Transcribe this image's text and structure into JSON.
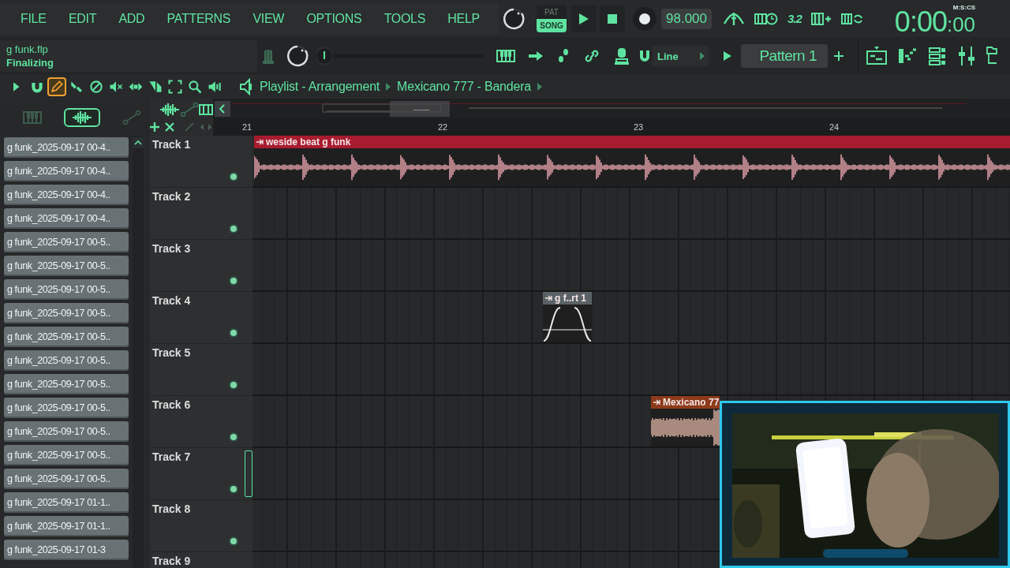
{
  "menu": [
    "FILE",
    "EDIT",
    "ADD",
    "PATTERNS",
    "VIEW",
    "OPTIONS",
    "TOOLS",
    "HELP"
  ],
  "transport": {
    "modes": [
      {
        "label": "PAT",
        "selected": false
      },
      {
        "label": "SONG",
        "selected": true
      }
    ],
    "tempo": "98.000",
    "step_readout": "3.2",
    "time": "0:00",
    "time_centis": ":00",
    "time_format": "M:S:CS"
  },
  "hint_bar": {
    "title": "g funk.flp",
    "message": "Finalizing"
  },
  "master_slider": {
    "level": 0.06
  },
  "snap": {
    "value": "Line"
  },
  "pattern": {
    "value": "Pattern 1"
  },
  "playlist_tools": [
    {
      "selected": false
    },
    {
      "selected": false
    },
    {
      "selected": true
    },
    {
      "selected": false
    },
    {
      "selected": false
    },
    {
      "selected": false
    },
    {
      "selected": false
    },
    {
      "selected": false
    },
    {
      "selected": false
    },
    {
      "selected": false
    },
    {
      "selected": false
    }
  ],
  "breadcrumb": [
    "Playlist - Arrangement",
    "Mexicano 777 - Bandera"
  ],
  "browser": {
    "filters": [
      {
        "selected": false
      },
      {
        "selected": true
      },
      {
        "selected": false
      }
    ],
    "files": [
      "g funk_2025-09-17 00-4..",
      "g funk_2025-09-17 00-4..",
      "g funk_2025-09-17 00-4..",
      "g funk_2025-09-17 00-4..",
      "g funk_2025-09-17 00-5..",
      "g funk_2025-09-17 00-5..",
      "g funk_2025-09-17 00-5..",
      "g funk_2025-09-17 00-5..",
      "g funk_2025-09-17 00-5..",
      "g funk_2025-09-17 00-5..",
      "g funk_2025-09-17 00-5..",
      "g funk_2025-09-17 00-5..",
      "g funk_2025-09-17 00-5..",
      "g funk_2025-09-17 00-5..",
      "g funk_2025-09-17 00-5..",
      "g funk_2025-09-17 01-1..",
      "g funk_2025-09-17 01-1..",
      "g funk_2025-09-17 01-3"
    ]
  },
  "ruler": [
    "21",
    "22",
    "23",
    "24"
  ],
  "tracks": [
    {
      "name": "Track 1",
      "selected": false,
      "enabled": true,
      "clips": [
        {
          "kind": "audio",
          "label": "weside beat g funk",
          "color": "#a81c30"
        }
      ]
    },
    {
      "name": "Track 2",
      "selected": false,
      "enabled": true
    },
    {
      "name": "Track 3",
      "selected": false,
      "enabled": true
    },
    {
      "name": "Track 4",
      "selected": false,
      "enabled": true,
      "clips": [
        {
          "kind": "automation",
          "label": "g f..rt 1",
          "color": "#5a6266"
        }
      ]
    },
    {
      "name": "Track 5",
      "selected": false,
      "enabled": true
    },
    {
      "name": "Track 6",
      "selected": false,
      "enabled": true,
      "clips": [
        {
          "kind": "audio",
          "label": "Mexicano 77",
          "color": "#8e3a1a"
        }
      ]
    },
    {
      "name": "Track 7",
      "selected": true,
      "enabled": true
    },
    {
      "name": "Track 8",
      "selected": false,
      "enabled": true
    },
    {
      "name": "Track 9",
      "selected": false
    }
  ],
  "overlay": {
    "kind": "picture"
  }
}
